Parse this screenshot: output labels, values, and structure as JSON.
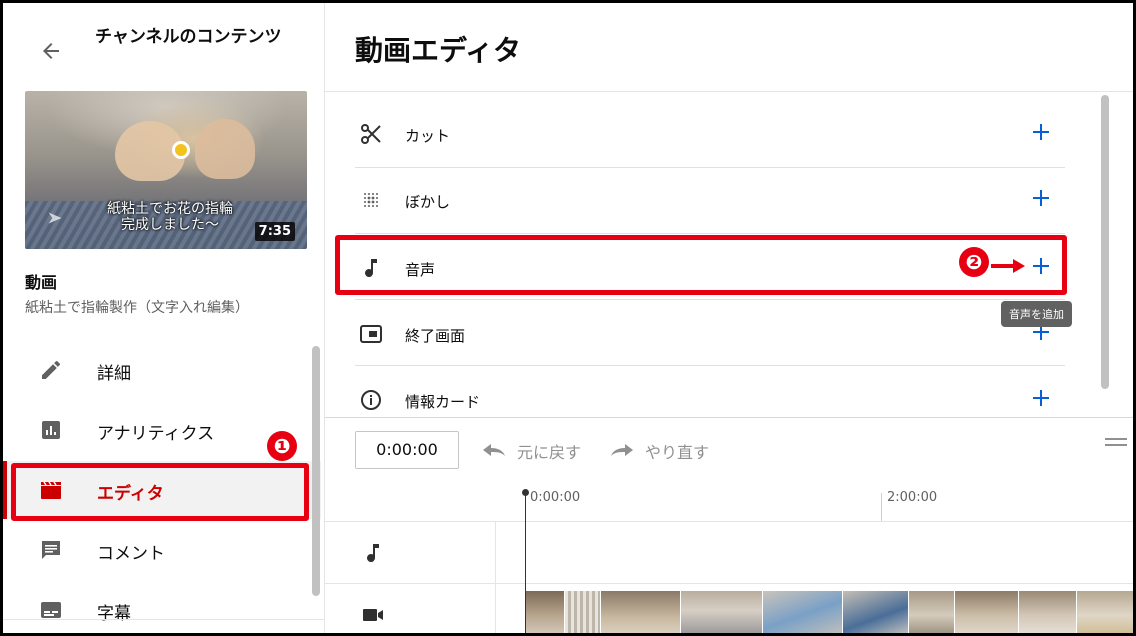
{
  "sidebar": {
    "title": "チャンネルのコンテンツ",
    "video": {
      "thumbnail_caption": "紙粘土でお花の指輪\n完成しました〜",
      "duration": "7:35",
      "label": "動画",
      "name": "紙粘土で指輪製作（文字入れ編集）"
    },
    "nav": [
      {
        "label": "詳細",
        "icon": "pencil-icon"
      },
      {
        "label": "アナリティクス",
        "icon": "analytics-icon"
      },
      {
        "label": "エディタ",
        "icon": "clapperboard-icon",
        "active": true
      },
      {
        "label": "コメント",
        "icon": "comment-icon"
      },
      {
        "label": "字幕",
        "icon": "subtitles-icon"
      }
    ]
  },
  "main": {
    "title": "動画エディタ",
    "tools": [
      {
        "label": "カット",
        "icon": "scissors-icon"
      },
      {
        "label": "ぼかし",
        "icon": "blur-icon"
      },
      {
        "label": "音声",
        "icon": "music-note-icon"
      },
      {
        "label": "終了画面",
        "icon": "end-screen-icon"
      },
      {
        "label": "情報カード",
        "icon": "info-icon"
      }
    ],
    "tooltip": "音声を追加",
    "timeline": {
      "timecode": "0:00:00",
      "undo_label": "元に戻す",
      "redo_label": "やり直す",
      "ruler": [
        "0:00:00",
        "2:00:00"
      ]
    }
  },
  "annotations": {
    "badge1": "❶",
    "badge2": "❷",
    "color": "#e60012"
  },
  "colors": {
    "accent_blue": "#065fd4",
    "active_red": "#cc0000"
  }
}
